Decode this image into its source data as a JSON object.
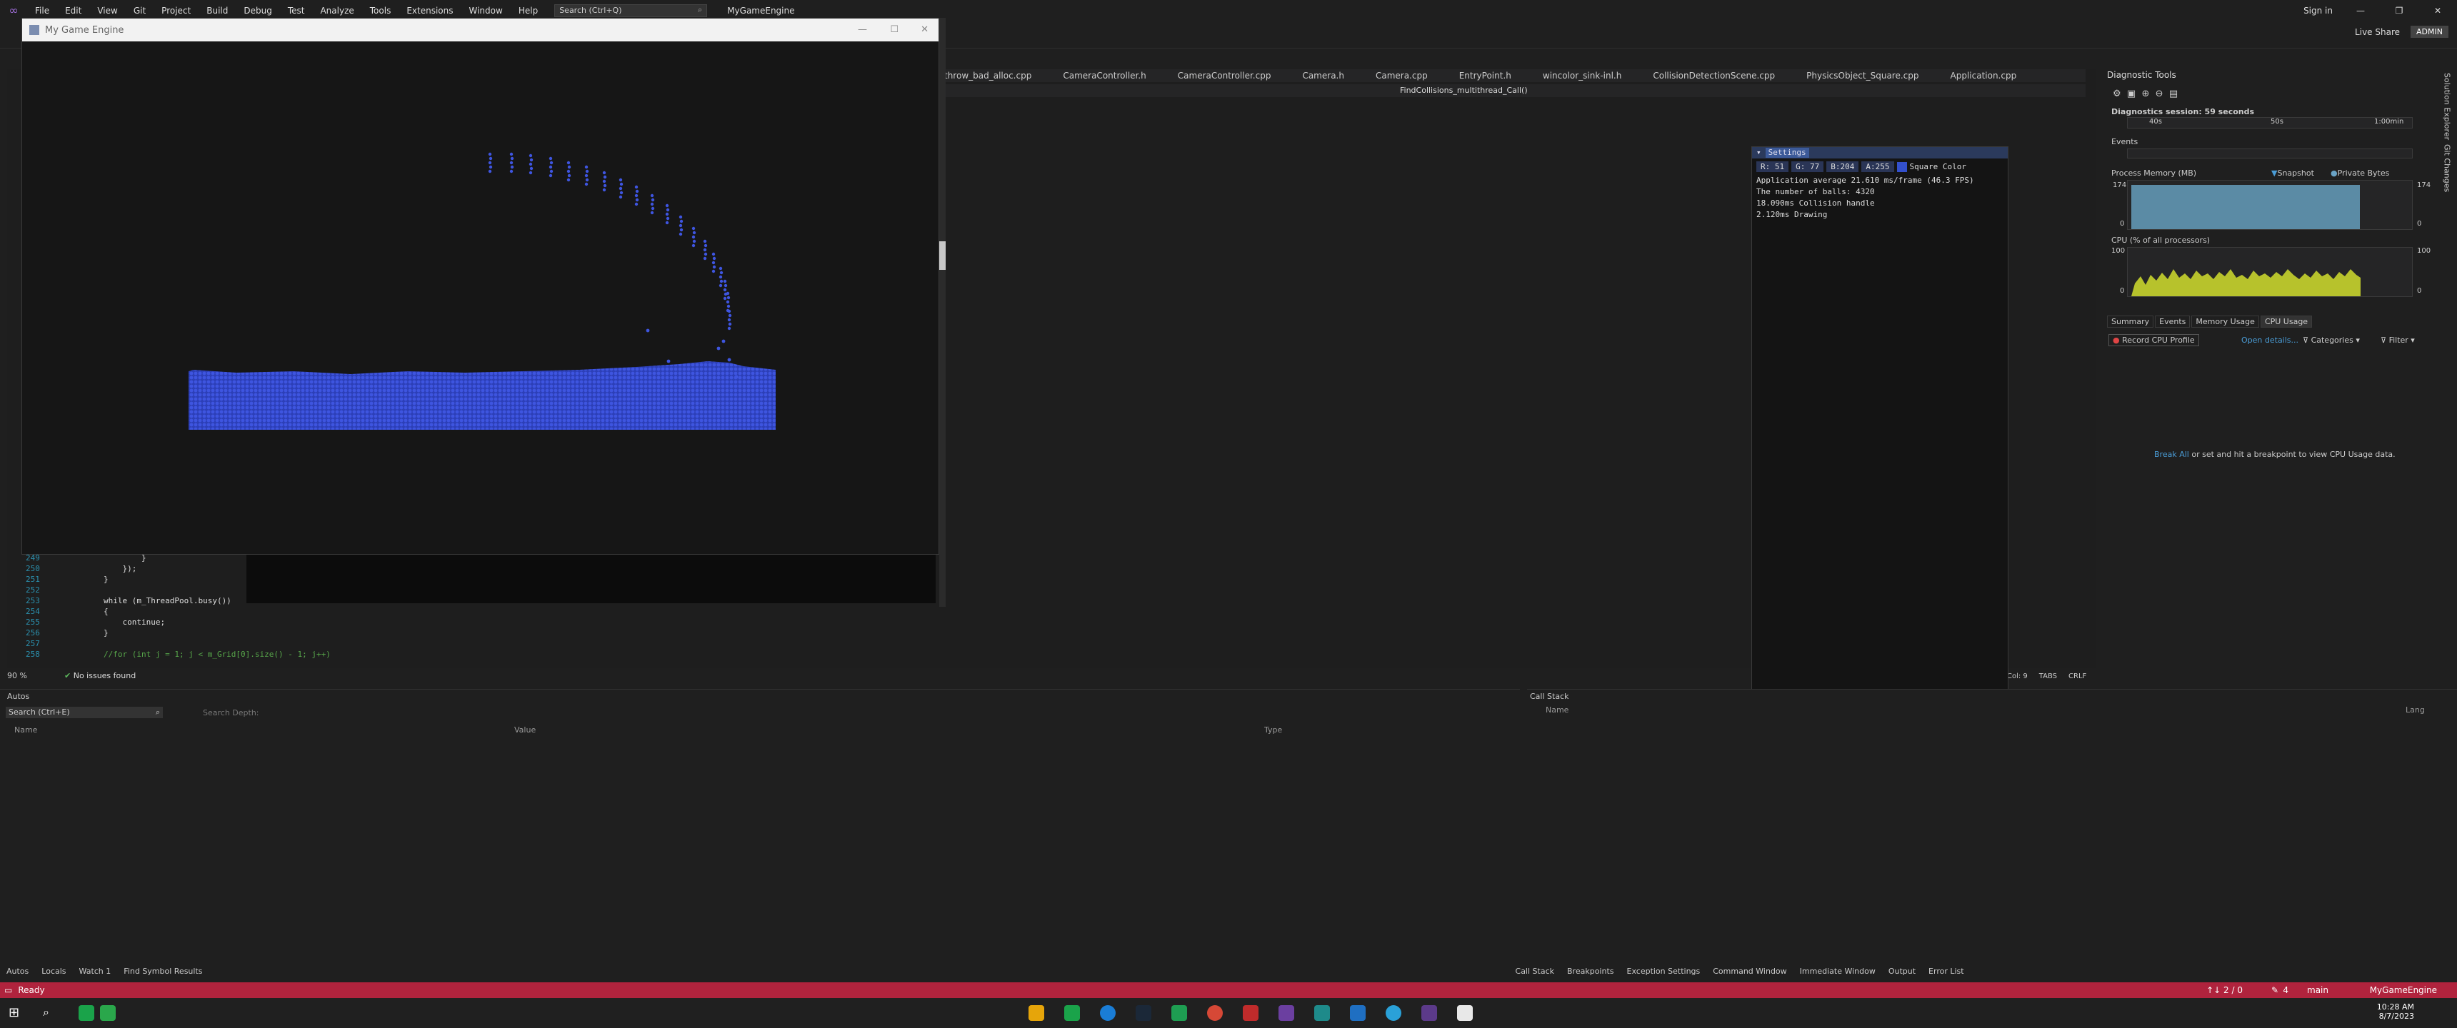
{
  "menu": [
    "File",
    "Edit",
    "View",
    "Git",
    "Project",
    "Build",
    "Debug",
    "Test",
    "Analyze",
    "Tools",
    "Extensions",
    "Window",
    "Help"
  ],
  "search_placeholder": "Search (Ctrl+Q)",
  "project_name": "MyGameEngine",
  "topright": {
    "signin": "Sign in",
    "liveshare": "Live Share",
    "admin": "ADMIN"
  },
  "tabs": [
    "throw_bad_alloc.cpp",
    "CameraController.h",
    "CameraController.cpp",
    "Camera.h",
    "Camera.cpp",
    "EntryPoint.h",
    "wincolor_sink-inl.h",
    "CollisionDetectionScene.cpp",
    "PhysicsObject_Square.cpp",
    "Application.cpp"
  ],
  "nav_function": "FindCollisions_multithread_Call()",
  "game_window": {
    "title": "My Game Engine"
  },
  "settings": {
    "header": "Settings",
    "r": "R: 51",
    "g": "G: 77",
    "b": "B:204",
    "a": "A:255",
    "color_label": "Square Color",
    "line1": "Application average 21.610 ms/frame (46.3 FPS)",
    "line2": "The number of balls: 4320",
    "line3": "18.090ms Collision handle",
    "line4": "2.120ms Drawing"
  },
  "code": {
    "lines": [
      "249",
      "250",
      "251",
      "252",
      "253",
      "254",
      "255",
      "256",
      "257",
      "258"
    ],
    "text": [
      "        }",
      "    });",
      "}",
      "",
      "while (m_ThreadPool.busy())",
      "{",
      "    continue;",
      "}",
      "",
      "//for (int j = 1; j < m_Grid[0].size() - 1; j++)"
    ],
    "zoom": "90 %",
    "issues": "No issues found"
  },
  "diagnostics": {
    "title": "Diagnostic Tools",
    "session": "Diagnostics session: 59 seconds",
    "timeline": [
      "40s",
      "50s",
      "1:00min"
    ],
    "events": "Events",
    "memory_title": "Process Memory (MB)",
    "snapshot": "Snapshot",
    "private": "Private Bytes",
    "mem_max": "174",
    "mem_min": "0",
    "cpu_title": "CPU (% of all processors)",
    "cpu_max": "100",
    "cpu_min": "0",
    "tabs": [
      "Summary",
      "Events",
      "Memory Usage",
      "CPU Usage"
    ],
    "record": "Record CPU Profile",
    "open_details": "Open details...",
    "categories": "Categories",
    "filter": "Filter",
    "break_link": "Break All",
    "break_text": " or set and hit a breakpoint to view CPU Usage data."
  },
  "autos": {
    "title": "Autos",
    "search": "Search (Ctrl+E)",
    "depth": "Search Depth:",
    "cols": [
      "Name",
      "Value",
      "Type"
    ]
  },
  "callstack": {
    "title": "Call Stack",
    "cols": [
      "Name",
      "Lang"
    ]
  },
  "bottom_tabs_left": [
    "Autos",
    "Locals",
    "Watch 1",
    "Find Symbol Results"
  ],
  "bottom_tabs_right": [
    "Call Stack",
    "Breakpoints",
    "Exception Settings",
    "Command Window",
    "Immediate Window",
    "Output",
    "Error List"
  ],
  "status": {
    "ready": "Ready",
    "nav": "↑↓ 2 / 0",
    "edits": "4",
    "branch": "main",
    "project": "MyGameEngine"
  },
  "editor_status": {
    "col": "Col: 9",
    "tabs": "TABS",
    "crlf": "CRLF"
  },
  "sideTabs": [
    "Solution Explorer",
    "Git Changes"
  ],
  "clock": {
    "time": "10:28 AM",
    "date": "8/7/2023"
  }
}
